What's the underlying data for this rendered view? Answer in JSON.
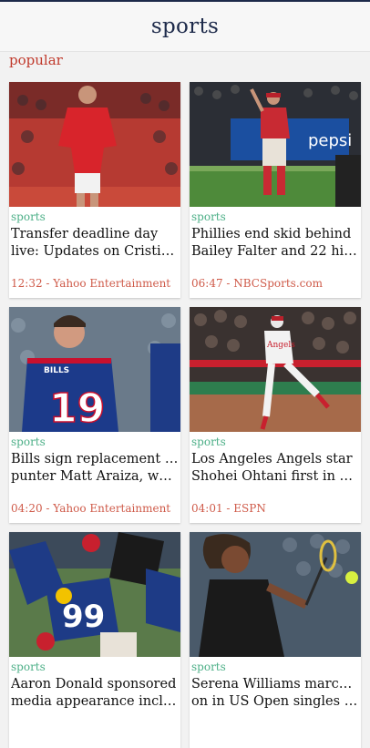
{
  "header": {
    "title": "sports"
  },
  "section": {
    "label": "popular"
  },
  "cards": [
    {
      "category": "sports",
      "title_line1": "Transfer deadline day",
      "title_line2": "live: Updates on Cristian...",
      "meta": "12:32 - Yahoo Entertainment",
      "image": "soccer-player-red-kit"
    },
    {
      "category": "sports",
      "title_line1": "Phillies end skid behind",
      "title_line2": "Bailey Falter and 22 hits ...",
      "meta": "06:47 - NBCSports.com",
      "image": "baseball-player-red-jersey"
    },
    {
      "category": "sports",
      "title_line1": "Bills sign replacement for",
      "title_line2": "punter Matt Araiza, who...",
      "meta": "04:20 - Yahoo Entertainment",
      "image": "football-player-19",
      "jersey_number": "19",
      "jersey_name": "BILLS"
    },
    {
      "category": "sports",
      "title_line1": "Los Angeles Angels star",
      "title_line2": "Shohei Ohtani first in M...",
      "meta": "04:01 - ESPN",
      "image": "baseball-runner-angels",
      "jersey_name": "Angels"
    },
    {
      "category": "sports",
      "title_line1": "Aaron Donald sponsored",
      "title_line2": "media appearance inclu...",
      "meta": "",
      "image": "football-tackle-99",
      "jersey_number": "99"
    },
    {
      "category": "sports",
      "title_line1": "Serena Williams marches",
      "title_line2": "on in US Open singles p...",
      "meta": "",
      "image": "tennis-player-racket"
    }
  ],
  "image_text": {
    "pepsi": "pepsi"
  },
  "colors": {
    "header_text": "#1d2a4a",
    "accent_red": "#c0392b",
    "category_green": "#4caf87",
    "meta_red": "#cf5b4a"
  }
}
